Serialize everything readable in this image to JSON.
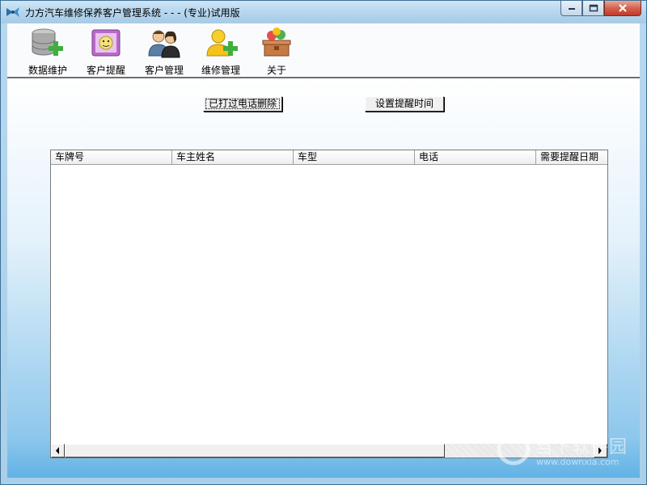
{
  "window": {
    "title": "力方汽车维修保养客户管理系统 - - - (专业)试用版"
  },
  "toolbar": {
    "items": [
      {
        "label": "数据维护",
        "icon": "database-add-icon"
      },
      {
        "label": "客户提醒",
        "icon": "reminder-calendar-icon"
      },
      {
        "label": "客户管理",
        "icon": "customers-icon"
      },
      {
        "label": "维修管理",
        "icon": "user-add-icon"
      },
      {
        "label": "关于",
        "icon": "about-box-icon"
      }
    ]
  },
  "actions": {
    "delete_called": "已打过电话删除",
    "set_reminder_time": "设置提醒时间"
  },
  "list": {
    "columns": [
      "车牌号",
      "车主姓名",
      "车型",
      "电话",
      "需要提醒日期"
    ]
  },
  "watermark": {
    "text": "当下软件园",
    "url": "www.downxia.com"
  },
  "colors": {
    "accent": "#62b2e6",
    "close_button": "#c0392b"
  }
}
